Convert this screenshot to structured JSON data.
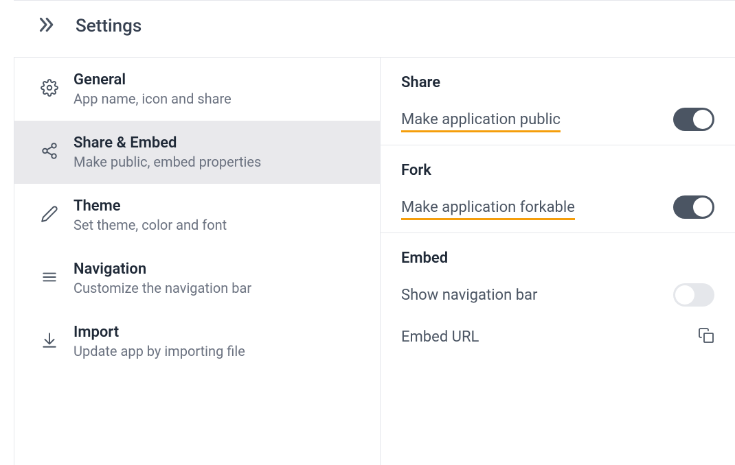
{
  "header": {
    "title": "Settings"
  },
  "sidebar": {
    "items": [
      {
        "title": "General",
        "desc": "App name, icon and share",
        "active": false
      },
      {
        "title": "Share & Embed",
        "desc": "Make public, embed properties",
        "active": true
      },
      {
        "title": "Theme",
        "desc": "Set theme, color and font",
        "active": false
      },
      {
        "title": "Navigation",
        "desc": "Customize the navigation bar",
        "active": false
      },
      {
        "title": "Import",
        "desc": "Update app by importing file",
        "active": false
      }
    ]
  },
  "detail": {
    "share": {
      "title": "Share",
      "label": "Make application public",
      "toggle": true
    },
    "fork": {
      "title": "Fork",
      "label": "Make application forkable",
      "toggle": true
    },
    "embed": {
      "title": "Embed",
      "show_nav_label": "Show navigation bar",
      "show_nav_toggle": false,
      "embed_url_label": "Embed URL"
    }
  }
}
